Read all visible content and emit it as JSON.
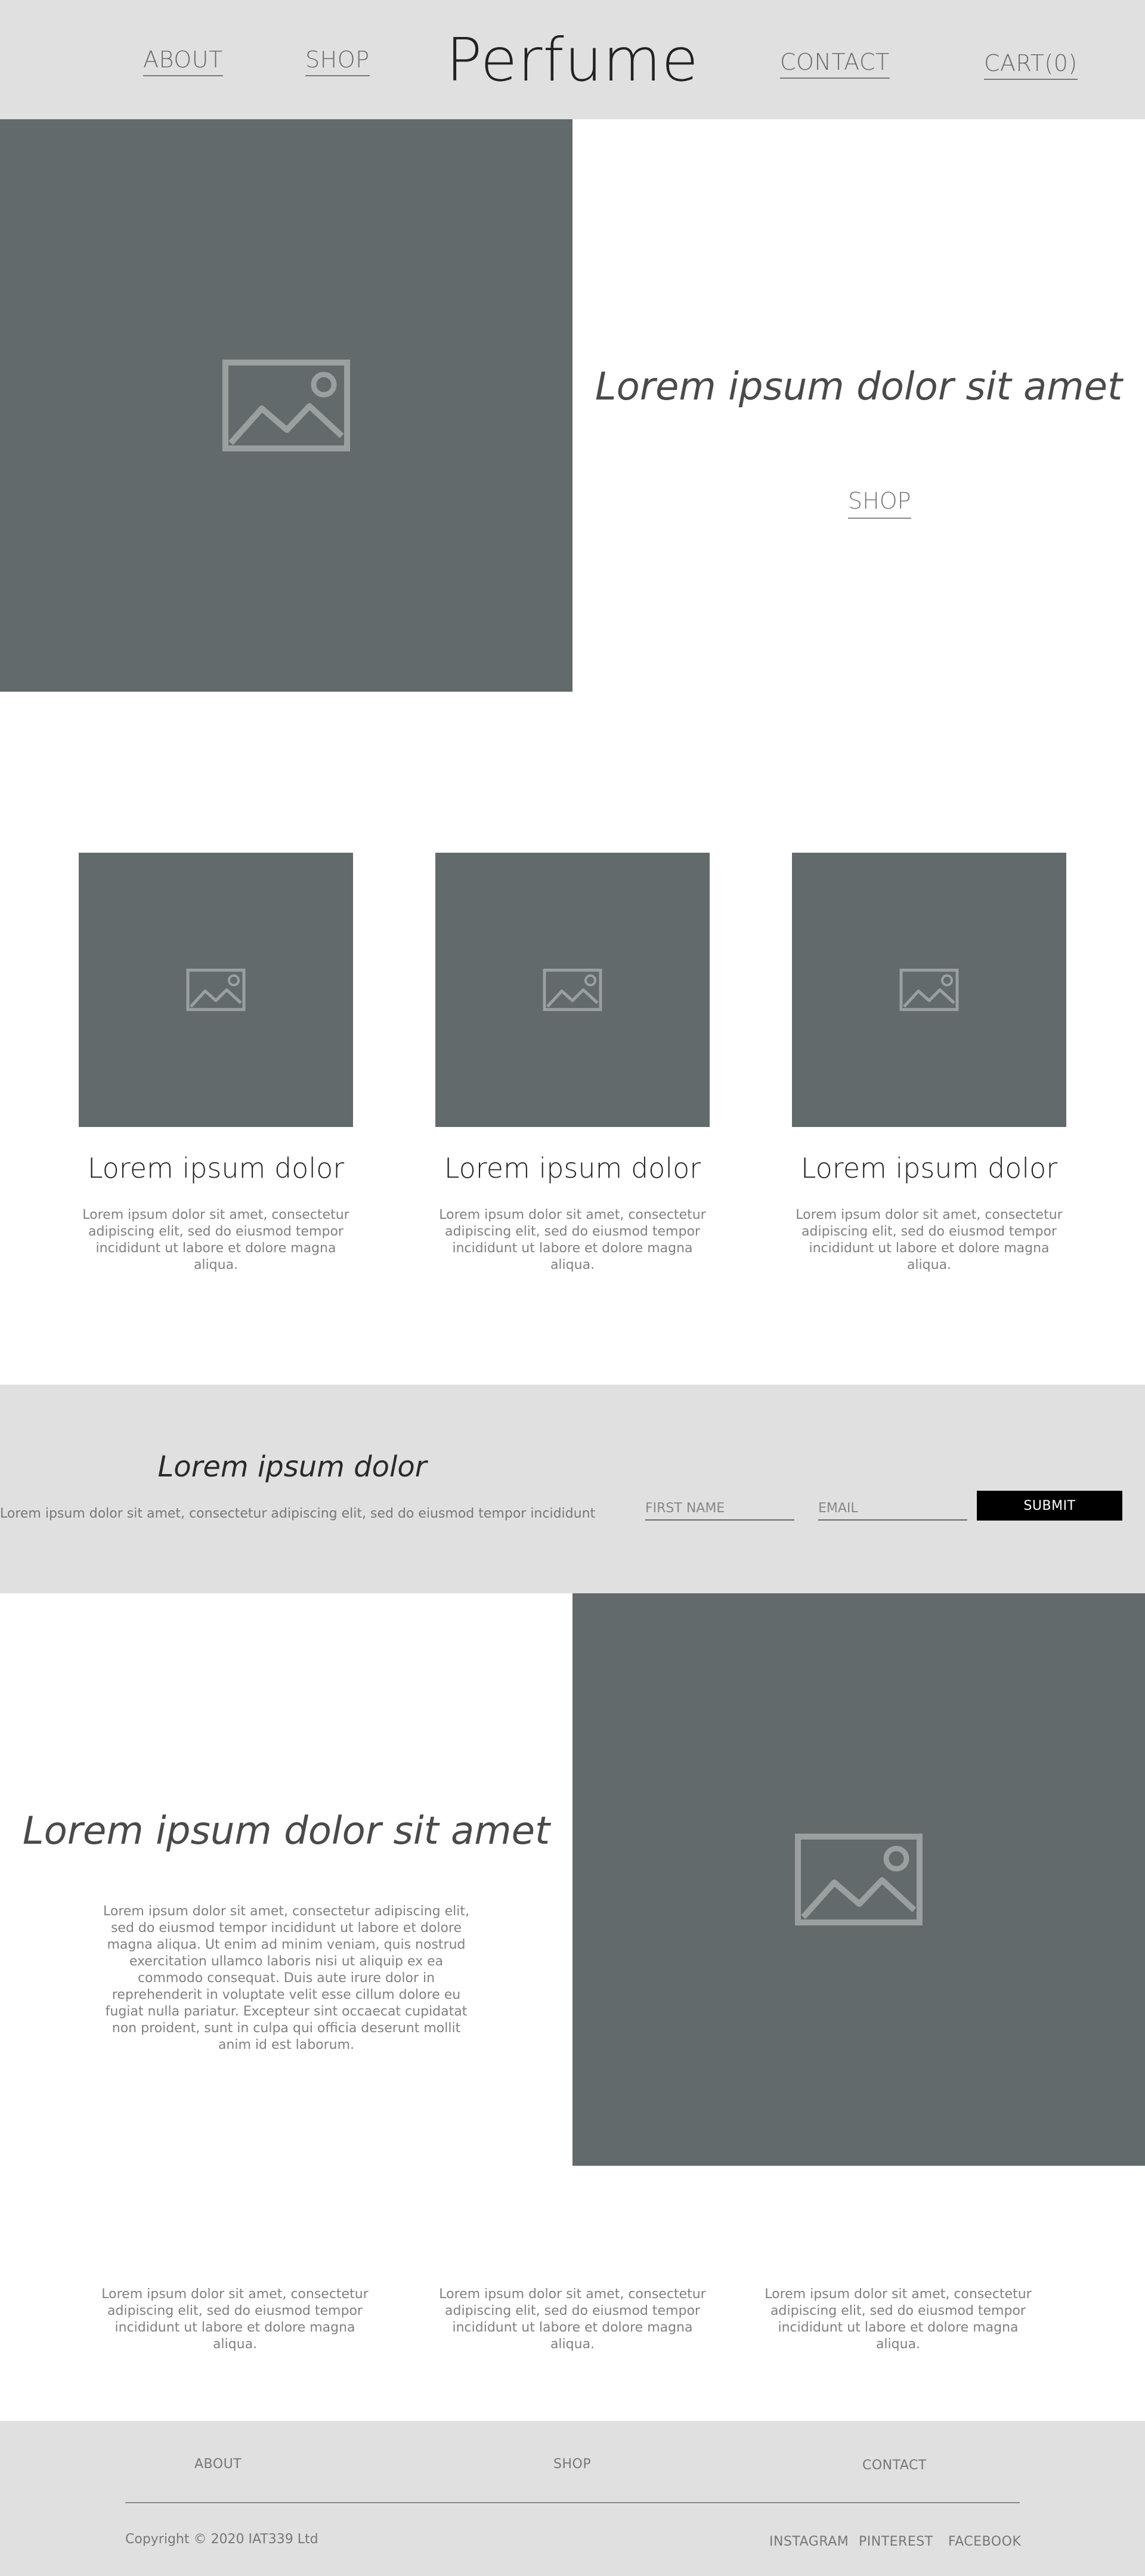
{
  "header": {
    "brand": "Perfume",
    "nav_left": [
      "ABOUT",
      "SHOP"
    ],
    "nav_right": [
      "CONTACT",
      "CART(0)"
    ]
  },
  "hero": {
    "title": "Lorem ipsum dolor sit amet",
    "cta": "SHOP",
    "image_icon": "image-placeholder-icon"
  },
  "products": [
    {
      "title": "Lorem ipsum dolor",
      "text": "Lorem ipsum dolor sit amet, consectetur adipiscing elit, sed do eiusmod tempor incididunt ut labore et dolore magna aliqua."
    },
    {
      "title": "Lorem ipsum dolor",
      "text": "Lorem ipsum dolor sit amet, consectetur adipiscing elit, sed do eiusmod tempor incididunt ut labore et dolore magna aliqua."
    },
    {
      "title": "Lorem ipsum dolor",
      "text": "Lorem ipsum dolor sit amet, consectetur adipiscing elit, sed do eiusmod tempor incididunt ut labore et dolore magna aliqua."
    }
  ],
  "newsletter": {
    "title": "Lorem ipsum dolor",
    "text": "Lorem ipsum dolor sit amet, consectetur adipiscing elit, sed do eiusmod tempor incididunt",
    "first_name_placeholder": "FIRST NAME",
    "email_placeholder": "EMAIL",
    "submit": "SUBMIT"
  },
  "feature": {
    "title": "Lorem ipsum dolor sit amet",
    "text": "Lorem ipsum dolor sit amet, consectetur adipiscing elit, sed do eiusmod tempor incididunt ut labore et dolore magna aliqua. Ut enim ad minim veniam, quis nostrud exercitation ullamco laboris nisi ut aliquip ex ea commodo consequat. Duis aute irure dolor in reprehenderit in voluptate velit esse cillum dolore eu fugiat nulla pariatur. Excepteur sint occaecat cupidatat non proident, sunt in culpa qui officia deserunt mollit anim id est laborum."
  },
  "columns": [
    "Lorem ipsum dolor sit amet, consectetur adipiscing elit, sed do eiusmod tempor incididunt ut labore et dolore magna aliqua.",
    "Lorem ipsum dolor sit amet, consectetur adipiscing elit, sed do eiusmod tempor incididunt ut labore et dolore magna aliqua.",
    "Lorem ipsum dolor sit amet, consectetur adipiscing elit, sed do eiusmod tempor incididunt ut labore et dolore magna aliqua."
  ],
  "footer": {
    "links": [
      "ABOUT",
      "SHOP",
      "CONTACT"
    ],
    "copyright": "Copyright © 2020 IAT339 Ltd",
    "social": [
      "INSTAGRAM",
      "PINTEREST",
      "FACEBOOK"
    ]
  },
  "colors": {
    "band_gray": "#e0e0e0",
    "image_placeholder": "#626a6b",
    "button_black": "#000000"
  }
}
